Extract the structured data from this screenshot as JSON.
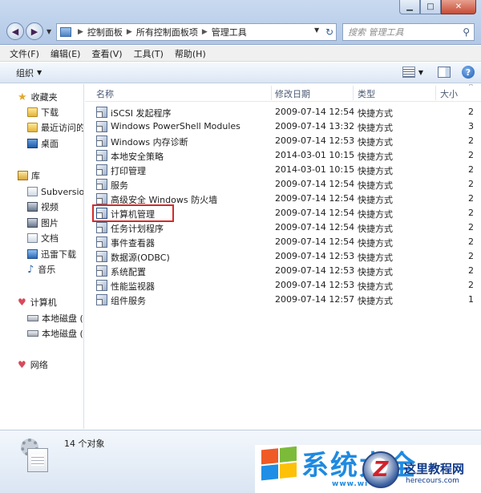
{
  "address": {
    "crumbs": [
      "控制面板",
      "所有控制面板项",
      "管理工具"
    ]
  },
  "search": {
    "placeholder": "搜索 管理工具"
  },
  "menu": [
    "文件(F)",
    "编辑(E)",
    "查看(V)",
    "工具(T)",
    "帮助(H)"
  ],
  "toolbar": {
    "organize": "组织"
  },
  "nav": {
    "favorites": "收藏夹",
    "favorites_items": [
      "下载",
      "最近访问的",
      "桌面"
    ],
    "libraries": "库",
    "library_items": [
      "Subversion",
      "视频",
      "图片",
      "文档",
      "迅雷下载",
      "音乐"
    ],
    "computer": "计算机",
    "computer_items": [
      "本地磁盘 (C",
      "本地磁盘 (D"
    ],
    "network": "网络"
  },
  "columns": {
    "name": "名称",
    "date": "修改日期",
    "type": "类型",
    "size": "大小"
  },
  "files": [
    {
      "name": "iSCSI 发起程序",
      "date": "2009-07-14 12:54",
      "type": "快捷方式",
      "size": "2"
    },
    {
      "name": "Windows PowerShell Modules",
      "date": "2009-07-14 13:32",
      "type": "快捷方式",
      "size": "3"
    },
    {
      "name": "Windows 内存诊断",
      "date": "2009-07-14 12:53",
      "type": "快捷方式",
      "size": "2"
    },
    {
      "name": "本地安全策略",
      "date": "2014-03-01 10:15",
      "type": "快捷方式",
      "size": "2"
    },
    {
      "name": "打印管理",
      "date": "2014-03-01 10:15",
      "type": "快捷方式",
      "size": "2"
    },
    {
      "name": "服务",
      "date": "2009-07-14 12:54",
      "type": "快捷方式",
      "size": "2"
    },
    {
      "name": "高级安全 Windows 防火墙",
      "date": "2009-07-14 12:54",
      "type": "快捷方式",
      "size": "2"
    },
    {
      "name": "计算机管理",
      "date": "2009-07-14 12:54",
      "type": "快捷方式",
      "size": "2"
    },
    {
      "name": "任务计划程序",
      "date": "2009-07-14 12:54",
      "type": "快捷方式",
      "size": "2"
    },
    {
      "name": "事件查看器",
      "date": "2009-07-14 12:54",
      "type": "快捷方式",
      "size": "2"
    },
    {
      "name": "数据源(ODBC)",
      "date": "2009-07-14 12:53",
      "type": "快捷方式",
      "size": "2"
    },
    {
      "name": "系统配置",
      "date": "2009-07-14 12:53",
      "type": "快捷方式",
      "size": "2"
    },
    {
      "name": "性能监视器",
      "date": "2009-07-14 12:53",
      "type": "快捷方式",
      "size": "2"
    },
    {
      "name": "组件服务",
      "date": "2009-07-14 12:57",
      "type": "快捷方式",
      "size": "1"
    }
  ],
  "status": {
    "count": "14 个对象"
  },
  "watermark": {
    "brand": "系统大全",
    "brand_sub": "www.wi",
    "site": "这里教程网",
    "url": "herecours.com"
  },
  "colors": {
    "highlight": "#d42a2a",
    "accent": "#1f8ae0"
  }
}
